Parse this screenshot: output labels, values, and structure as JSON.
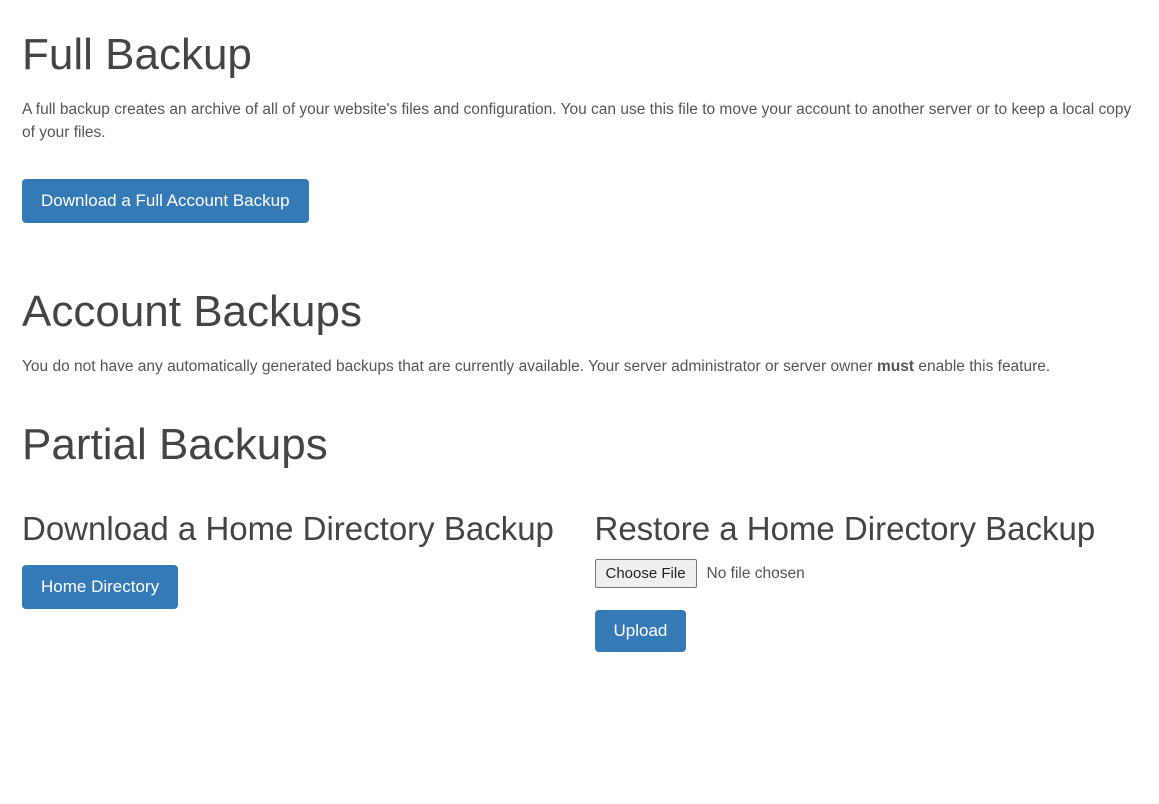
{
  "full_backup": {
    "title": "Full Backup",
    "description": "A full backup creates an archive of all of your website's files and configuration. You can use this file to move your account to another server or to keep a local copy of your files.",
    "download_button": "Download a Full Account Backup"
  },
  "account_backups": {
    "title": "Account Backups",
    "description_pre": "You do not have any automatically generated backups that are currently available. Your server administrator or server owner ",
    "description_bold": "must",
    "description_post": " enable this feature."
  },
  "partial_backups": {
    "title": "Partial Backups",
    "download_section": {
      "title": "Download a Home Directory Backup",
      "button": "Home Directory"
    },
    "restore_section": {
      "title": "Restore a Home Directory Backup",
      "choose_file": "Choose File",
      "file_status": "No file chosen",
      "upload_button": "Upload"
    }
  }
}
